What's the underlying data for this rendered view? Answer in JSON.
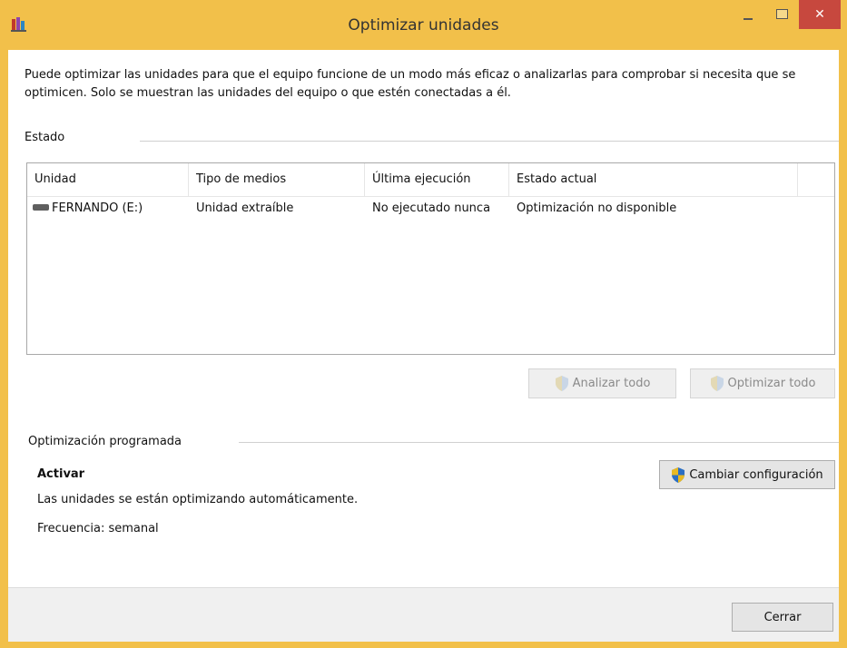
{
  "window": {
    "title": "Optimizar unidades",
    "close_glyph": "✕",
    "accent": "#f2c04a"
  },
  "description": "Puede optimizar las unidades para que el equipo funcione de un modo más eficaz o analizarlas para comprobar si necesita que se optimicen. Solo se muestran las unidades del equipo o que estén conectadas a él.",
  "status_section": {
    "label": "Estado",
    "columns": [
      "Unidad",
      "Tipo de medios",
      "Última ejecución",
      "Estado actual"
    ],
    "rows": [
      {
        "unidad": "FERNANDO (E:)",
        "tipo": "Unidad extraíble",
        "ultima": "No ejecutado nunca",
        "estado": "Optimización no disponible"
      }
    ],
    "analyze_all_label": "Analizar todo",
    "optimize_all_label": "Optimizar todo"
  },
  "scheduled_section": {
    "label": "Optimización programada",
    "state_label": "Activar",
    "status_text": "Las unidades se están optimizando automáticamente.",
    "frequency_text": "Frecuencia: semanal",
    "change_settings_label": "Cambiar configuración"
  },
  "footer": {
    "close_label": "Cerrar"
  }
}
